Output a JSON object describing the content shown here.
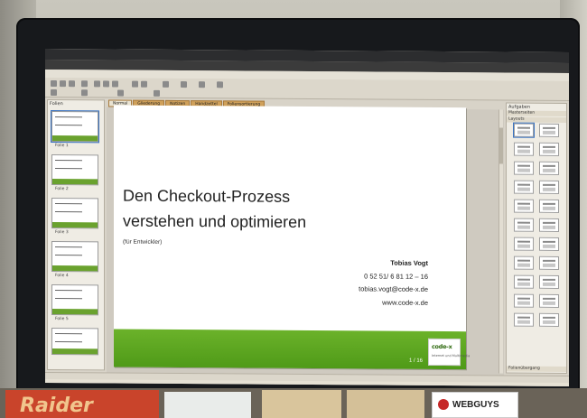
{
  "slide": {
    "title_line1": "Den Checkout-Prozess",
    "title_line2": "verstehen und optimieren",
    "subtitle": "(für Entwickler)",
    "author": "Tobias Vogt",
    "phone": "0 52 51/  6 81 12 – 16",
    "email": "tobias.vogt@code-x.de",
    "web": "www.code-x.de",
    "page": "1 / 16",
    "logo_text": "code-x",
    "logo_sub": "Internet und Multimedia"
  },
  "tabs": [
    "Normal",
    "Gliederung",
    "Notizen",
    "Handzettel",
    "Foliensortierung"
  ],
  "tasks": {
    "title": "Aufgaben",
    "sections": [
      "Masterseiten",
      "Layouts"
    ],
    "bottom_sections": [
      "Folienübergang"
    ]
  },
  "slides_pane_title": "Folien",
  "thumb_labels": [
    "Folie 1",
    "Folie 2",
    "Folie 3",
    "Folie 4",
    "Folie 5"
  ],
  "colors": {
    "footer_green": "#5aa61f",
    "thumb_green": "#6aa22e",
    "slide_bg": "#ffffff"
  },
  "bottom_items": {
    "box1": "Raider",
    "box2": "WEBGUYS"
  }
}
